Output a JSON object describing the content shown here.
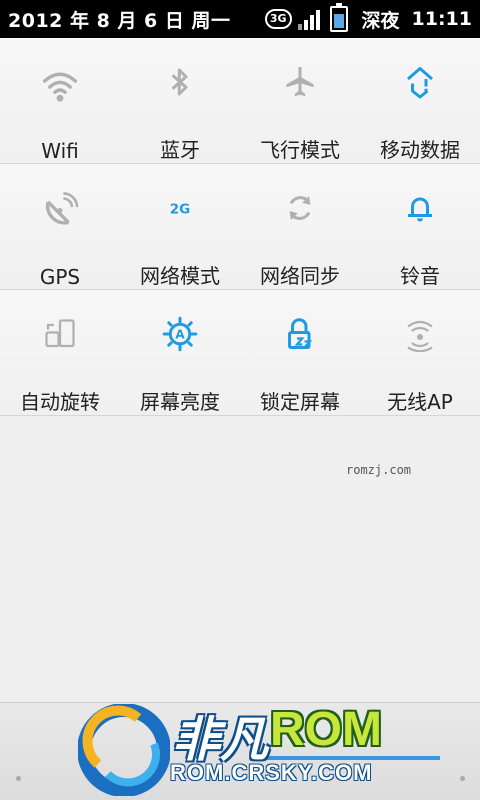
{
  "statusbar": {
    "date": "2012 年 8 月 6 日 周一",
    "network_badge": "3G",
    "carrier": "深夜",
    "time": "11:11"
  },
  "toggles": [
    {
      "label": "Wifi",
      "icon": "wifi-icon",
      "state": "off"
    },
    {
      "label": "蓝牙",
      "icon": "bluetooth-icon",
      "state": "off"
    },
    {
      "label": "飞行模式",
      "icon": "airplane-icon",
      "state": "off"
    },
    {
      "label": "移动数据",
      "icon": "mobile-data-icon",
      "state": "on"
    },
    {
      "label": "GPS",
      "icon": "gps-icon",
      "state": "off"
    },
    {
      "label": "网络模式",
      "icon": "network-mode-icon",
      "state": "on",
      "icon_text": "2G"
    },
    {
      "label": "网络同步",
      "icon": "sync-icon",
      "state": "off"
    },
    {
      "label": "铃音",
      "icon": "bell-icon",
      "state": "on"
    },
    {
      "label": "自动旋转",
      "icon": "rotate-icon",
      "state": "off"
    },
    {
      "label": "屏幕亮度",
      "icon": "brightness-icon",
      "state": "on"
    },
    {
      "label": "锁定屏幕",
      "icon": "lock-icon",
      "state": "on"
    },
    {
      "label": "无线AP",
      "icon": "hotspot-icon",
      "state": "off"
    }
  ],
  "watermark_text": "romzj.com",
  "logo": {
    "cn": "非凡",
    "rom": "ROM",
    "url": "ROM.CRSKY.COM"
  },
  "colors": {
    "accent": "#1e9be2",
    "off": "#b0b0b0",
    "statusbar_bg": "#000000"
  }
}
